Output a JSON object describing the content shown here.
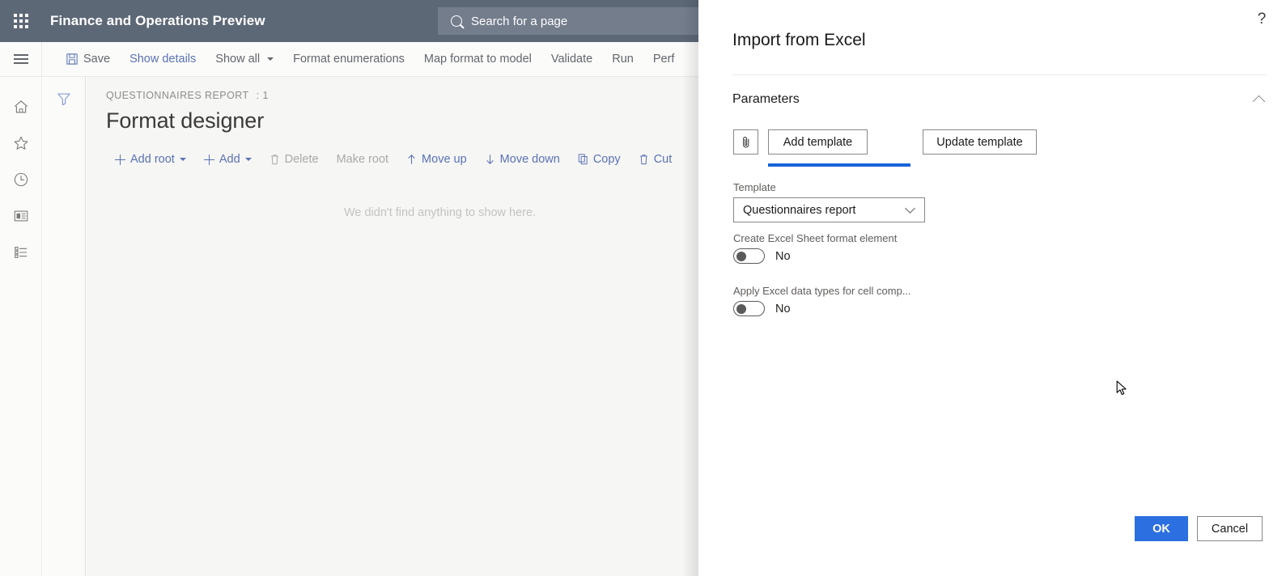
{
  "navbar": {
    "app_launcher_icon": "waffle-grid-icon",
    "title": "Finance and Operations Preview",
    "search_placeholder": "Search for a page",
    "search_icon": "search-icon"
  },
  "commandbar": {
    "menu_icon": "hamburger-icon",
    "items": [
      {
        "label": "Save",
        "icon": "save-floppy-icon",
        "style": "default",
        "has_caret": false
      },
      {
        "label": "Show details",
        "icon": "",
        "style": "link",
        "has_caret": false
      },
      {
        "label": "Show all",
        "icon": "",
        "style": "default",
        "has_caret": true
      },
      {
        "label": "Format enumerations",
        "icon": "",
        "style": "default",
        "has_caret": false
      },
      {
        "label": "Map format to model",
        "icon": "",
        "style": "default",
        "has_caret": false
      },
      {
        "label": "Validate",
        "icon": "",
        "style": "default",
        "has_caret": false
      },
      {
        "label": "Run",
        "icon": "",
        "style": "default",
        "has_caret": false
      },
      {
        "label": "Perf",
        "icon": "",
        "style": "default",
        "has_caret": false
      }
    ]
  },
  "rail": {
    "items": [
      {
        "name": "home",
        "icon": "home-icon"
      },
      {
        "name": "favorites",
        "icon": "star-icon"
      },
      {
        "name": "recent",
        "icon": "clock-icon"
      },
      {
        "name": "workspaces",
        "icon": "workspace-icon"
      },
      {
        "name": "modules",
        "icon": "list-icon"
      }
    ]
  },
  "filter_strip": {
    "icon": "filter-funnel-icon"
  },
  "page": {
    "breadcrumb": "QUESTIONNAIRES REPORT",
    "breadcrumb_suffix": ": 1",
    "title": "Format designer",
    "toolbar": [
      {
        "label": "Add root",
        "icon": "plus-icon",
        "caret": true,
        "disabled": false
      },
      {
        "label": "Add",
        "icon": "plus-icon",
        "caret": true,
        "disabled": false
      },
      {
        "label": "Delete",
        "icon": "trash-icon",
        "caret": false,
        "disabled": true
      },
      {
        "label": "Make root",
        "icon": "",
        "caret": false,
        "disabled": true
      },
      {
        "label": "Move up",
        "icon": "arrow-up-icon",
        "caret": false,
        "disabled": false
      },
      {
        "label": "Move down",
        "icon": "arrow-down-icon",
        "caret": false,
        "disabled": false
      },
      {
        "label": "Copy",
        "icon": "copy-icon",
        "caret": false,
        "disabled": false
      },
      {
        "label": "Cut",
        "icon": "trash-icon",
        "caret": false,
        "disabled": false
      }
    ],
    "empty_message": "We didn't find anything to show here."
  },
  "panel": {
    "help_icon": "?",
    "title": "Import from Excel",
    "section": {
      "label": "Parameters",
      "collapse_icon": "chevron-up-icon"
    },
    "attach_button": {
      "icon": "paperclip-icon",
      "label": ""
    },
    "add_template_button": "Add template",
    "update_template_button": "Update template",
    "template_field": {
      "label": "Template",
      "value": "Questionnaires report",
      "chevron_icon": "chevron-down-icon"
    },
    "create_sheet_toggle": {
      "label": "Create Excel Sheet format element",
      "value": "No",
      "checked": false
    },
    "apply_types_toggle": {
      "label": "Apply Excel data types for cell comp...",
      "value": "No",
      "checked": false
    },
    "ok_button": "OK",
    "cancel_button": "Cancel"
  },
  "colors": {
    "nav_background": "#5d6877",
    "nav_search_background": "#737d8c",
    "accent_blue": "#1664d8",
    "primary_button": "#2b6fe0",
    "link_blue": "#5a72b5",
    "page_background": "#f6f6f5",
    "panel_background": "#ffffff"
  }
}
